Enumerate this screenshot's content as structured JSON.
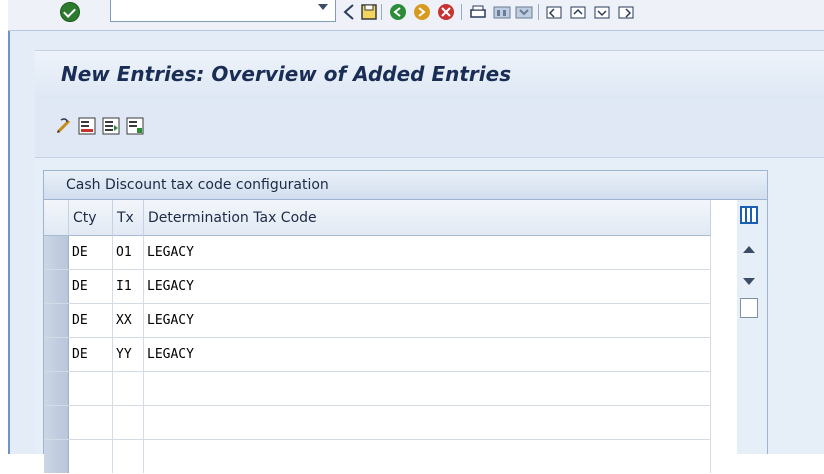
{
  "system_toolbar": {
    "enter_icon": "green-check-enter-icon",
    "command_field_value": "",
    "icons": [
      "back-icon",
      "save-icon",
      "back-nav-icon",
      "exit-icon",
      "cancel-icon",
      "print-icon",
      "find-icon",
      "find-next-icon",
      "first-page-icon",
      "previous-page-icon",
      "next-page-icon",
      "last-page-icon"
    ]
  },
  "screen": {
    "title": "New Entries: Overview of Added Entries"
  },
  "app_toolbar": {
    "icons": [
      "change-display-icon",
      "delete-icon",
      "select-all-icon",
      "deselect-all-icon"
    ]
  },
  "table": {
    "title": "Cash Discount tax code configuration",
    "columns": [
      "Cty",
      "Tx",
      "Determination Tax Code"
    ],
    "rows": [
      [
        "DE",
        "O1",
        "LEGACY"
      ],
      [
        "DE",
        "I1",
        "LEGACY"
      ],
      [
        "DE",
        "XX",
        "LEGACY"
      ],
      [
        "DE",
        "YY",
        "LEGACY"
      ],
      [
        "",
        "",
        ""
      ],
      [
        "",
        "",
        ""
      ],
      [
        "",
        "",
        ""
      ]
    ]
  },
  "colors": {
    "title_text": "#1a2d55",
    "frame_blue": "#6f93c6",
    "enter_green": "#2c7a2c"
  }
}
